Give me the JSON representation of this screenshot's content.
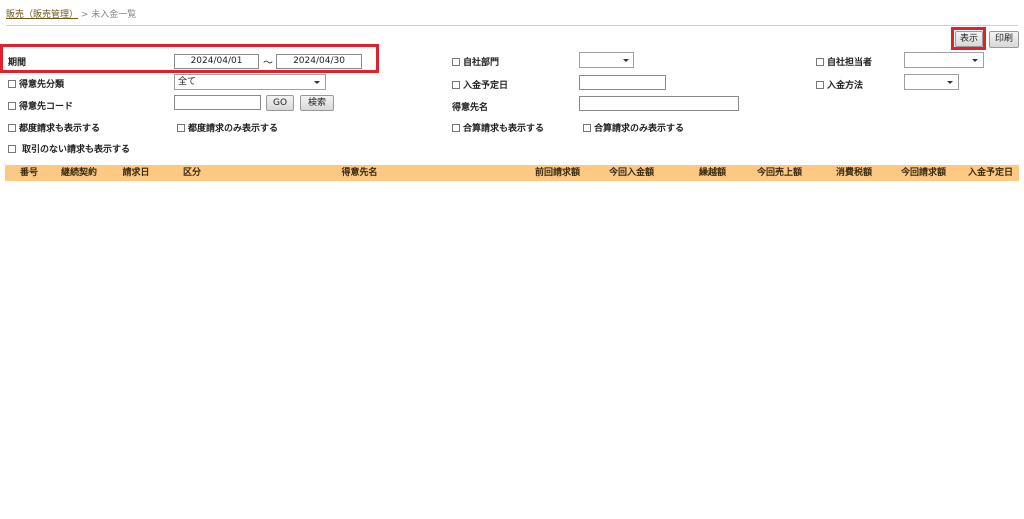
{
  "breadcrumb": {
    "parent": "販売（販売管理）",
    "separator": " > ",
    "current": "未入金一覧"
  },
  "buttons": {
    "show": "表示",
    "print": "印刷",
    "go": "GO",
    "search": "検索"
  },
  "filters": {
    "period": {
      "label": "期間",
      "from": "2024/04/01",
      "tilde": "〜",
      "to": "2024/04/30"
    },
    "customer_class": {
      "label": "得意先分類",
      "value": "全て"
    },
    "customer_code": {
      "label": "得意先コード",
      "value": ""
    },
    "own_department": {
      "label": "自社部門",
      "value": ""
    },
    "payment_due_date": {
      "label": "入金予定日",
      "value": ""
    },
    "customer_name": {
      "label": "得意先名",
      "value": ""
    },
    "own_staff": {
      "label": "自社担当者",
      "value": ""
    },
    "payment_method": {
      "label": "入金方法",
      "value": ""
    },
    "check_adhoc_also": "都度請求も表示する",
    "check_adhoc_only": "都度請求のみ表示する",
    "check_combined_also": "合算請求も表示する",
    "check_combined_only": "合算請求のみ表示する",
    "check_no_transactions": "取引のない請求も表示する"
  },
  "table": {
    "columns": [
      "番号",
      "継続契約",
      "請求日",
      "区分",
      "得意先名",
      "前回請求額",
      "今回入金額",
      "繰越額",
      "今回売上額",
      "消費税額",
      "今回請求額",
      "入金予定日"
    ]
  },
  "colors": {
    "header_bg": "#fdc882",
    "highlight": "#e0202c"
  }
}
